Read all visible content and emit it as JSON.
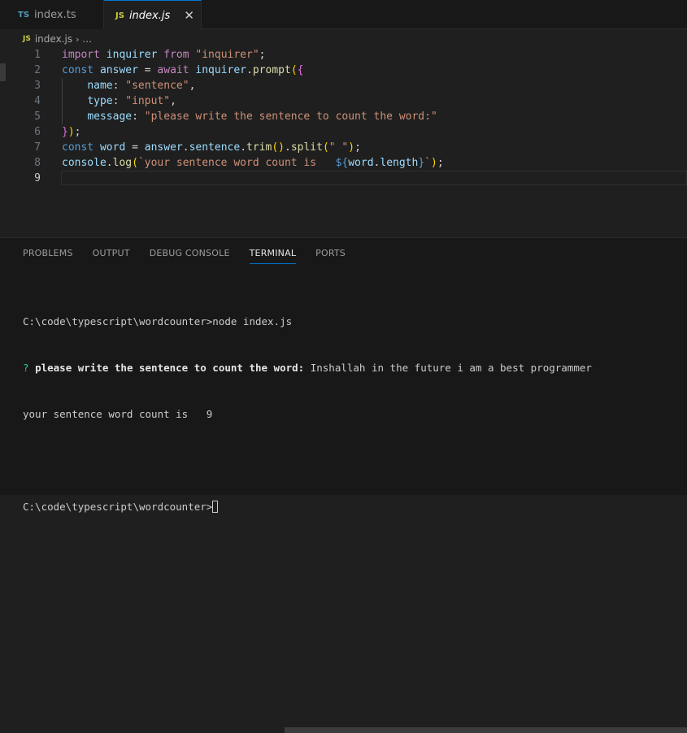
{
  "tabs": [
    {
      "lang": "TS",
      "label": "index.ts"
    },
    {
      "lang": "JS",
      "label": "index.js",
      "close": "✕"
    }
  ],
  "breadcrumb": {
    "lang": "JS",
    "file": "index.js",
    "sep": "›",
    "more": "..."
  },
  "editor": {
    "lines": [
      {
        "n": "1",
        "tokens": [
          [
            "kw2",
            "import"
          ],
          [
            "pun",
            " "
          ],
          [
            "var",
            "inquirer"
          ],
          [
            "pun",
            " "
          ],
          [
            "kw2",
            "from"
          ],
          [
            "pun",
            " "
          ],
          [
            "str",
            "\"inquirer\""
          ],
          [
            "pun",
            ";"
          ]
        ]
      },
      {
        "n": "2",
        "tokens": [
          [
            "kw",
            "const"
          ],
          [
            "pun",
            " "
          ],
          [
            "var",
            "answer"
          ],
          [
            "pun",
            " = "
          ],
          [
            "kw2",
            "await"
          ],
          [
            "pun",
            " "
          ],
          [
            "var",
            "inquirer"
          ],
          [
            "pun",
            "."
          ],
          [
            "fn",
            "prompt"
          ],
          [
            "br1",
            "("
          ],
          [
            "br2",
            "{"
          ]
        ]
      },
      {
        "n": "3",
        "tokens": [
          [
            "pun",
            "    "
          ],
          [
            "var",
            "name"
          ],
          [
            "pun",
            ": "
          ],
          [
            "str",
            "\"sentence\""
          ],
          [
            "pun",
            ","
          ]
        ]
      },
      {
        "n": "4",
        "tokens": [
          [
            "pun",
            "    "
          ],
          [
            "var",
            "type"
          ],
          [
            "pun",
            ": "
          ],
          [
            "str",
            "\"input\""
          ],
          [
            "pun",
            ","
          ]
        ]
      },
      {
        "n": "5",
        "tokens": [
          [
            "pun",
            "    "
          ],
          [
            "var",
            "message"
          ],
          [
            "pun",
            ": "
          ],
          [
            "str",
            "\"please write the sentence to count the word:\""
          ]
        ]
      },
      {
        "n": "6",
        "tokens": [
          [
            "br2",
            "}"
          ],
          [
            "br1",
            ")"
          ],
          [
            "pun",
            ";"
          ]
        ]
      },
      {
        "n": "7",
        "tokens": [
          [
            "kw",
            "const"
          ],
          [
            "pun",
            " "
          ],
          [
            "var",
            "word"
          ],
          [
            "pun",
            " = "
          ],
          [
            "var",
            "answer"
          ],
          [
            "pun",
            "."
          ],
          [
            "var",
            "sentence"
          ],
          [
            "pun",
            "."
          ],
          [
            "fn",
            "trim"
          ],
          [
            "br1",
            "()"
          ],
          [
            "pun",
            "."
          ],
          [
            "fn",
            "split"
          ],
          [
            "br1",
            "("
          ],
          [
            "str",
            "\" \""
          ],
          [
            "br1",
            ")"
          ],
          [
            "pun",
            ";"
          ]
        ]
      },
      {
        "n": "8",
        "tokens": [
          [
            "var",
            "console"
          ],
          [
            "pun",
            "."
          ],
          [
            "fn",
            "log"
          ],
          [
            "br1",
            "("
          ],
          [
            "str",
            "`your sentence word count is   "
          ],
          [
            "kw",
            "${"
          ],
          [
            "var",
            "word"
          ],
          [
            "pun",
            "."
          ],
          [
            "var",
            "length"
          ],
          [
            "kw",
            "}"
          ],
          [
            "str",
            "`"
          ],
          [
            "br1",
            ")"
          ],
          [
            "pun",
            ";"
          ]
        ]
      },
      {
        "n": "9",
        "tokens": []
      }
    ]
  },
  "panel": {
    "tabs": [
      "PROBLEMS",
      "OUTPUT",
      "DEBUG CONSOLE",
      "TERMINAL",
      "PORTS"
    ],
    "active_tab": "TERMINAL"
  },
  "terminal": {
    "cmd_line": "C:\\code\\typescript\\wordcounter>node index.js",
    "q_mark": "?",
    "q_text": "please write the sentence to count the word:",
    "answer": " Inshallah in the future i am a best programmer",
    "result": "your sentence word count is   9",
    "prompt": "C:\\code\\typescript\\wordcounter>"
  },
  "colors": {
    "accent": "#0078d4",
    "editor_bg": "#1f1f1f",
    "panel_bg": "#181818"
  }
}
